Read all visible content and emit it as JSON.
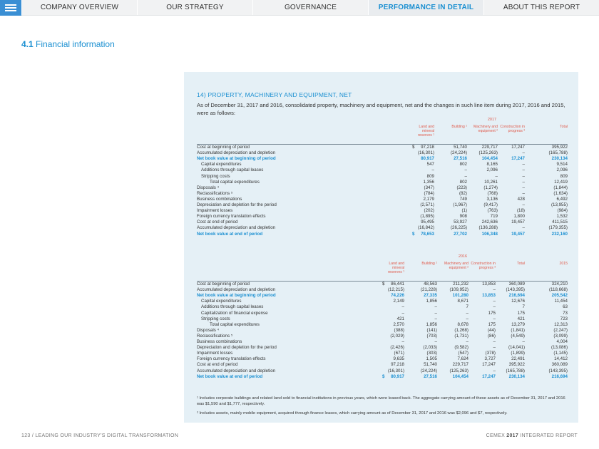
{
  "nav": {
    "tabs": [
      {
        "label": "COMPANY OVERVIEW"
      },
      {
        "label": "OUR STRATEGY"
      },
      {
        "label": "GOVERNANCE"
      },
      {
        "label": "PERFORMANCE IN DETAIL"
      },
      {
        "label": "ABOUT THIS REPORT"
      }
    ],
    "active_index": 3
  },
  "section": {
    "number": "4.1",
    "title": "Financial information"
  },
  "note": {
    "heading": "14) PROPERTY, MACHINERY AND EQUIPMENT, NET",
    "intro": "As of December 31, 2017 and 2016, consolidated property, machinery and equipment, net and the changes in such line item during 2017, 2016 and 2015, were as follows:"
  },
  "table2017": {
    "year": "2017",
    "headers": [
      "Land and mineral reserves ¹",
      "Building ¹",
      "Machinery and equipment ²",
      "Construction in progress ³",
      "Total"
    ],
    "rows": [
      {
        "label": "Cost at beginning of period",
        "style": "normal",
        "dollar": "$",
        "v": [
          "97,218",
          "51,740",
          "229,717",
          "17,247",
          "395,922"
        ]
      },
      {
        "label": "Accumulated depreciation and depletion",
        "style": "normal",
        "v": [
          "(16,301)",
          "(24,224)",
          "(125,263)",
          "–",
          "(165,788)"
        ]
      },
      {
        "label": "Net book value at beginning of period",
        "style": "blue",
        "v": [
          "80,917",
          "27,516",
          "104,454",
          "17,247",
          "230,134"
        ]
      },
      {
        "label": "Capital expenditures",
        "style": "ind1",
        "v": [
          "547",
          "802",
          "8,165",
          "–",
          "9,514"
        ]
      },
      {
        "label": "Additions through capital leases",
        "style": "ind1",
        "v": [
          "–",
          "–",
          "2,096",
          "–",
          "2,096"
        ]
      },
      {
        "label": "Stripping costs",
        "style": "ind1",
        "v": [
          "809",
          "–",
          "–",
          "–",
          "809"
        ]
      },
      {
        "label": "Total capital expenditures",
        "style": "ind2",
        "v": [
          "1,356",
          "802",
          "10,261",
          "–",
          "12,419"
        ]
      },
      {
        "label": "Disposals ⁴",
        "style": "normal",
        "v": [
          "(347)",
          "(223)",
          "(1,274)",
          "–",
          "(1,844)"
        ]
      },
      {
        "label": "Reclassifications ⁵",
        "style": "normal",
        "v": [
          "(784)",
          "(82)",
          "(768)",
          "–",
          "(1,634)"
        ]
      },
      {
        "label": "Business combinations",
        "style": "normal",
        "v": [
          "2,179",
          "749",
          "3,136",
          "428",
          "6,492"
        ]
      },
      {
        "label": "Depreciation and depletion for the period",
        "style": "normal",
        "v": [
          "(2,571)",
          "(1,967)",
          "(9,417)",
          "–",
          "(13,955)"
        ]
      },
      {
        "label": "Impairment losses",
        "style": "normal",
        "v": [
          "(202)",
          "(1)",
          "(763)",
          "(18)",
          "(984)"
        ]
      },
      {
        "label": "Foreign currency translation effects",
        "style": "normal",
        "v": [
          "(1,895)",
          "908",
          "719",
          "1,800",
          "1,532"
        ]
      },
      {
        "label": "Cost at end of period",
        "style": "normal",
        "v": [
          "95,495",
          "53,927",
          "242,636",
          "19,457",
          "411,515"
        ]
      },
      {
        "label": "Accumulated depreciation and depletion",
        "style": "normal",
        "v": [
          "(16,842)",
          "(26,225)",
          "(136,288)",
          "–",
          "(179,355)"
        ]
      },
      {
        "label": "Net book value at end of period",
        "style": "blue",
        "dollar": "$",
        "v": [
          "78,653",
          "27,702",
          "106,348",
          "19,457",
          "232,160"
        ]
      }
    ]
  },
  "table2016": {
    "year": "2016",
    "year2015": "2015",
    "headers": [
      "Land and mineral reserves ¹",
      "Building ¹",
      "Machinery and equipment ²",
      "Construction in progress ³",
      "Total",
      "2015"
    ],
    "rows": [
      {
        "label": "Cost at beginning of period",
        "style": "normal",
        "dollar": "$",
        "v": [
          "86,441",
          "48,563",
          "211,232",
          "13,853",
          "360,089",
          "324,210"
        ]
      },
      {
        "label": "Accumulated depreciation and depletion",
        "style": "normal",
        "v": [
          "(12,215)",
          "(21,228)",
          "(109,952)",
          "–",
          "(143,395)",
          "(118,668)"
        ]
      },
      {
        "label": "Net book value at beginning of period",
        "style": "blue",
        "v": [
          "74,226",
          "27,335",
          "101,280",
          "13,853",
          "216,694",
          "205,542"
        ]
      },
      {
        "label": "Capital expenditures",
        "style": "ind1",
        "v": [
          "2,149",
          "1,856",
          "8,671",
          "–",
          "12,676",
          "11,454"
        ]
      },
      {
        "label": "Additions through capital leases",
        "style": "ind1",
        "v": [
          "–",
          "–",
          "7",
          "–",
          "7",
          "63"
        ]
      },
      {
        "label": "Capitalization of financial expense",
        "style": "ind1",
        "v": [
          "–",
          "–",
          "–",
          "175",
          "175",
          "73"
        ]
      },
      {
        "label": "Stripping costs",
        "style": "ind1",
        "v": [
          "421",
          "–",
          "–",
          "–",
          "421",
          "723"
        ]
      },
      {
        "label": "Total capital expenditures",
        "style": "ind2",
        "v": [
          "2,570",
          "1,856",
          "8,678",
          "175",
          "13,279",
          "12,313"
        ]
      },
      {
        "label": "Disposals ⁴",
        "style": "normal",
        "v": [
          "(388)",
          "(141)",
          "(1,268)",
          "(44)",
          "(1,841)",
          "(2,247)"
        ]
      },
      {
        "label": "Reclassifications ⁵",
        "style": "normal",
        "v": [
          "(2,029)",
          "(703)",
          "(1,731)",
          "(86)",
          "(4,549)",
          "(3,099)"
        ]
      },
      {
        "label": "Business combinations",
        "style": "normal",
        "v": [
          "–",
          "–",
          "–",
          "–",
          "–",
          "4,004"
        ]
      },
      {
        "label": "Depreciation and depletion for the period",
        "style": "normal",
        "v": [
          "(2,426)",
          "(2,033)",
          "(9,582)",
          "–",
          "(14,041)",
          "(13,086)"
        ]
      },
      {
        "label": "Impairment losses",
        "style": "normal",
        "v": [
          "(671)",
          "(303)",
          "(547)",
          "(378)",
          "(1,899)",
          "(1,145)"
        ]
      },
      {
        "label": "Foreign currency translation effects",
        "style": "normal",
        "v": [
          "9,635",
          "1,505",
          "7,624",
          "3,727",
          "22,491",
          "14,412"
        ]
      },
      {
        "label": "Cost at end of period",
        "style": "normal",
        "v": [
          "97,218",
          "51,740",
          "229,717",
          "17,247",
          "395,922",
          "360,089"
        ]
      },
      {
        "label": "Accumulated depreciation and depletion",
        "style": "normal",
        "v": [
          "(16,301)",
          "(24,224)",
          "(125,263)",
          "–",
          "(165,788)",
          "(143,395)"
        ]
      },
      {
        "label": "Net book value at end of period",
        "style": "blue",
        "dollar": "$",
        "v": [
          "80,917",
          "27,516",
          "104,454",
          "17,247",
          "230,134",
          "216,694"
        ]
      }
    ]
  },
  "footnotes": [
    "¹ Includes corporate buildings and related land sold to financial institutions in previous years, which were leased back. The aggregate carrying amount of these assets as of December 31, 2017 and 2016 was $1,590 and $1,777, respectively.",
    "² Includes assets, mainly mobile equipment, acquired through finance leases, which carrying amount as of December 31, 2017 and 2016 was $2,096 and $7, respectively."
  ],
  "footer": {
    "left": "123 / LEADING OUR INDUSTRY'S DIGITAL TRANSFORMATION",
    "right_prefix": "CEMEX ",
    "right_bold": "2017",
    "right_suffix": " INTEGRATED REPORT"
  },
  "colors": {
    "accent": "#1a8fd1",
    "header_red": "#e05a4b",
    "panel_bg": "#e5f0f6"
  }
}
